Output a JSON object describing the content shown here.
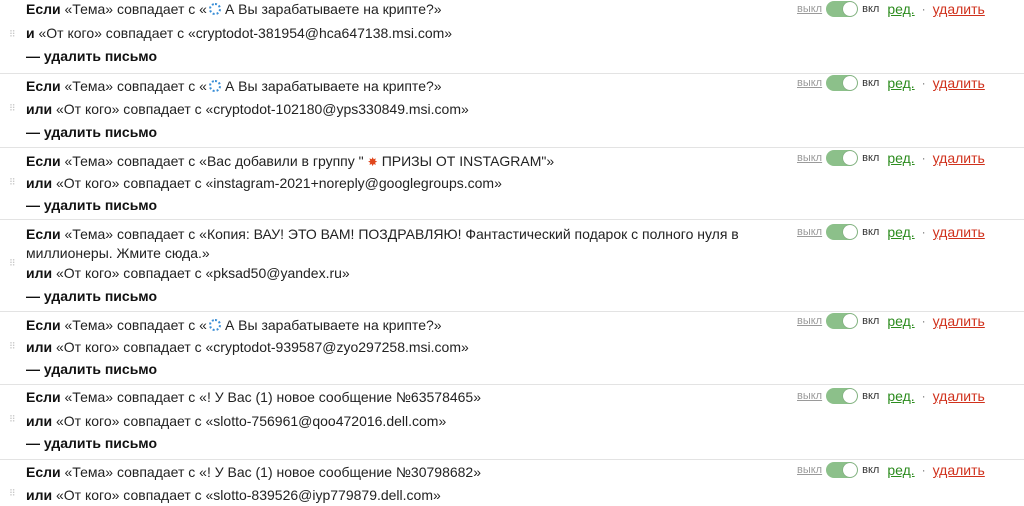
{
  "controls": {
    "off_label": "выкл",
    "on_label": "вкл",
    "edit_label": "ред.",
    "separator": "·",
    "delete_label": "удалить"
  },
  "common": {
    "if_kw": "Если",
    "action": "— удалить письмо"
  },
  "rules": [
    {
      "cond1_pre": "«Тема» совпадает с «",
      "cond1_icon": "crypto-icon",
      "cond1_text": "А Вы зарабатываете на крипте?»",
      "op": "и",
      "cond2": "«От кого» совпадает с «cryptodot-381954@hca647138.msi.com»"
    },
    {
      "cond1_pre": "«Тема» совпадает с «",
      "cond1_icon": "crypto-icon",
      "cond1_text": "А Вы зарабатываете на крипте?»",
      "op": "или",
      "cond2": "«От кого» совпадает с «cryptodot-102180@yps330849.msi.com»"
    },
    {
      "cond1_pre": "«Тема» совпадает с «Вас добавили в группу \"",
      "cond1_icon": "burst-icon",
      "cond1_text": "ПРИЗЫ ОТ INSTAGRAM\"»",
      "op": "или",
      "cond2": "«От кого» совпадает с «instagram-2021+noreply@googlegroups.com»"
    },
    {
      "cond1_text": "«Тема» совпадает с «Копия: ВАУ! ЭТО ВАМ! ПОЗДРАВЛЯЮ! Фантастический подарок с полного нуля в миллионеры. Жмите сюда.»",
      "op": "или",
      "cond2": "«От кого» совпадает с «pksad50@yandex.ru»"
    },
    {
      "cond1_pre": "«Тема» совпадает с «",
      "cond1_icon": "crypto-icon",
      "cond1_text": "А Вы зарабатываете на крипте?»",
      "op": "или",
      "cond2": "«От кого» совпадает с «cryptodot-939587@zyo297258.msi.com»"
    },
    {
      "cond1_text": "«Тема» совпадает с «! У Вас (1) новое сообщение №63578465»",
      "op": "или",
      "cond2": "«От кого» совпадает с «slotto-756961@qoo472016.dell.com»"
    },
    {
      "cond1_text": "«Тема» совпадает с «! У Вас (1) новое сообщение №30798682»",
      "op": "или",
      "cond2": "«От кого» совпадает с «slotto-839526@iyp779879.dell.com»"
    }
  ]
}
